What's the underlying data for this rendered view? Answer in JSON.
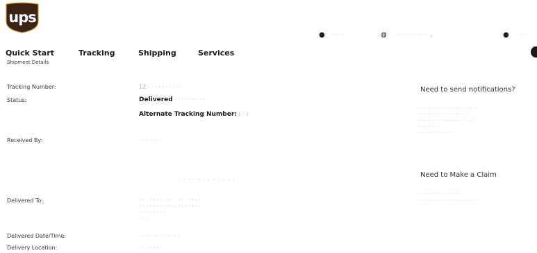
{
  "logo": {
    "text": "ups"
  },
  "utility": {
    "location_label": "· · ·  ·",
    "language_label": "· · ·  · · · · ·  ·  · ⌄",
    "account_label": "·  · ·"
  },
  "nav": {
    "tabs": [
      "Quick Start",
      "Tracking",
      "Shipping",
      "Services"
    ]
  },
  "subheading": "Shipment Details",
  "details": {
    "tracking_number_label": "Tracking Number:",
    "tracking_number_value": "1Z · · ·  · · · · ·  · ·",
    "status_label": "Status:",
    "status_value": "Delivered",
    "status_detail": "· · · ·  ·  · · ·  ·",
    "alternate_label": "Alternate Tracking Number:",
    "alternate_value": "( · )",
    "received_by_label": "Received By:",
    "received_by_value": "· · · · · · ·",
    "signature_line": "·  ·  ·   ·  ·  ·  · ·   ·  · ·  ·",
    "delivered_to_label": "Delivered To:",
    "delivered_to_lines": [
      "·  · · · ·  · · · · ·  · · · · · · · ·",
      "· · · · · · · · · · · ·  · · ·  ·  · ·",
      "·  · · · ·  ·  · ·",
      "· · ·"
    ],
    "delivered_datetime_label": "Delivered Date/Time:",
    "delivered_datetime_value": "· ·  · ·  · ·  · ·  · · · ·",
    "delivery_location_label": "Delivery Location:",
    "delivery_location_value": "· · · ·  · · ·"
  },
  "sidebar": {
    "notifications_heading": "Need to send notifications?",
    "notifications_lines": [
      "· · ·  · · · · · · · · ·  · · · ·  · · · ·",
      "· · ·  · · ·  · · · · · ·  · · · · ·",
      "· · · · · · ·  · · · · ·  · · · · · · ·",
      "· · · ·  · · · ·",
      "· · · · · · · · · · · ·"
    ],
    "claim_heading": "Need to Make a Claim",
    "claim_lines": [
      "· · · · · · ·  ·  · · · · · · ·",
      "· · · · · · · · ·  · · · · · · · · · · ·"
    ]
  }
}
